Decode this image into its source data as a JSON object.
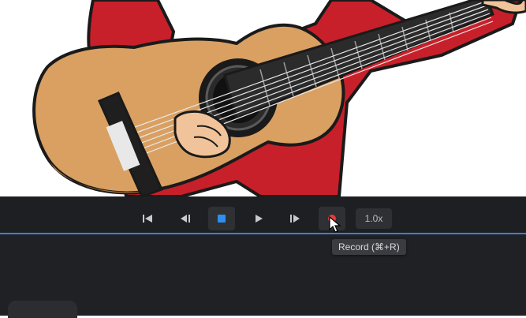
{
  "canvas": {
    "image": "guitar-player-illustration",
    "colors": {
      "shirt": "#c8202a",
      "guitar_body": "#d9a062",
      "outline": "#1a1a1a"
    }
  },
  "playback": {
    "buttons": [
      {
        "id": "skip-to-start",
        "icon": "skip-back-icon"
      },
      {
        "id": "step-back",
        "icon": "step-back-icon"
      },
      {
        "id": "stop",
        "icon": "stop-icon",
        "color": "#2f8ff0"
      },
      {
        "id": "play",
        "icon": "play-icon"
      },
      {
        "id": "step-forward",
        "icon": "step-forward-icon"
      },
      {
        "id": "record",
        "icon": "record-icon",
        "color": "#e23b3b"
      }
    ],
    "speed_label": "1.0x",
    "accent": "#3a7fd6"
  },
  "tooltip": {
    "text": "Record (⌘+R)"
  }
}
